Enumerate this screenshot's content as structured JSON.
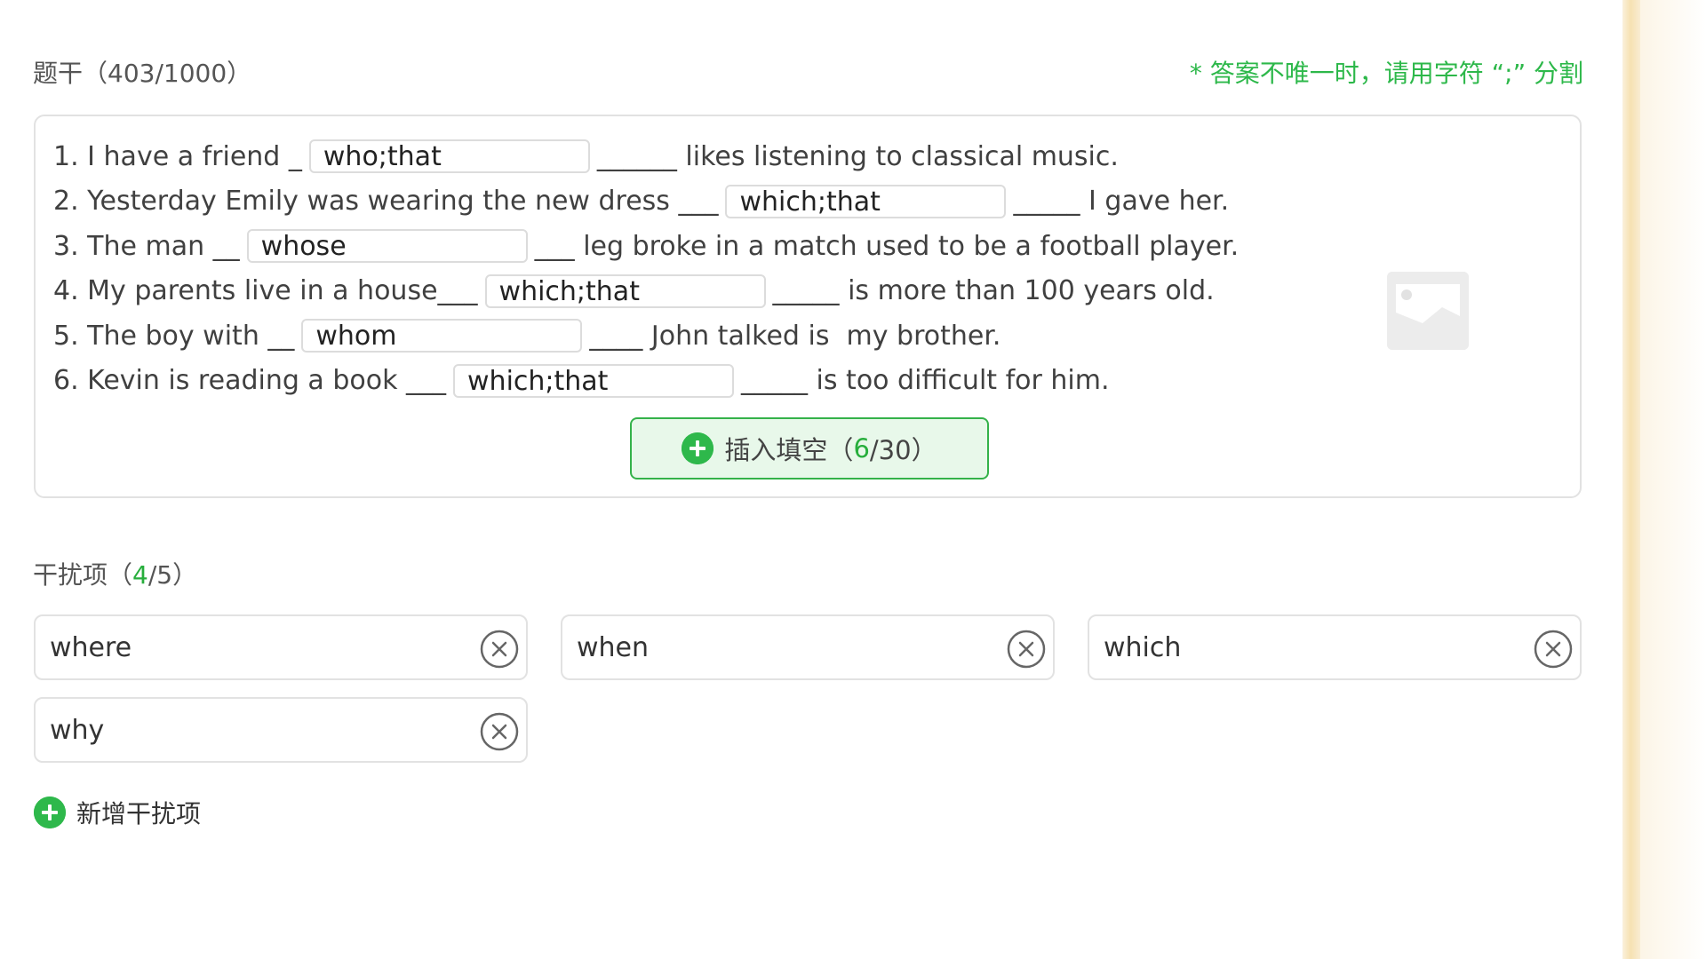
{
  "stem": {
    "label": "题干",
    "count_text": "（403/1000）",
    "hint": "* 答案不唯一时，请用字符 “;” 分割",
    "lines": [
      {
        "prefix": "1. I have a friend _",
        "answer": "who;that",
        "suffix": "______ likes listening to classical music."
      },
      {
        "prefix": "2. Yesterday Emily was wearing the new dress ___",
        "answer": "which;that",
        "suffix": "_____ I gave her."
      },
      {
        "prefix": "3. The man __",
        "answer": "whose",
        "suffix": "___ leg broke in a match used to be a football player."
      },
      {
        "prefix": "4. My parents live in a house___",
        "answer": "which;that",
        "suffix": "_____ is more than 100 years old."
      },
      {
        "prefix": "5. The boy with __",
        "answer": "whom",
        "suffix": "____ John talked is  my brother."
      },
      {
        "prefix": "6. Kevin is reading a book ___",
        "answer": "which;that",
        "suffix": "_____ is too difficult for him."
      }
    ],
    "insert_button": {
      "label": "插入填空（",
      "count": "6",
      "total": "/30）"
    }
  },
  "distractors": {
    "label": "干扰项（",
    "count": "4",
    "total": "/5）",
    "items": [
      {
        "value": "where"
      },
      {
        "value": "when"
      },
      {
        "value": "which"
      },
      {
        "value": "why"
      }
    ],
    "add_label": "新增干扰项"
  },
  "colors": {
    "accent_green": "#2eb84b",
    "insert_bg": "#e8f8ea",
    "border": "#e2e2e2"
  },
  "icons": {
    "plus": "plus-circle-icon",
    "remove": "close-circle-icon",
    "image": "image-placeholder-icon"
  }
}
